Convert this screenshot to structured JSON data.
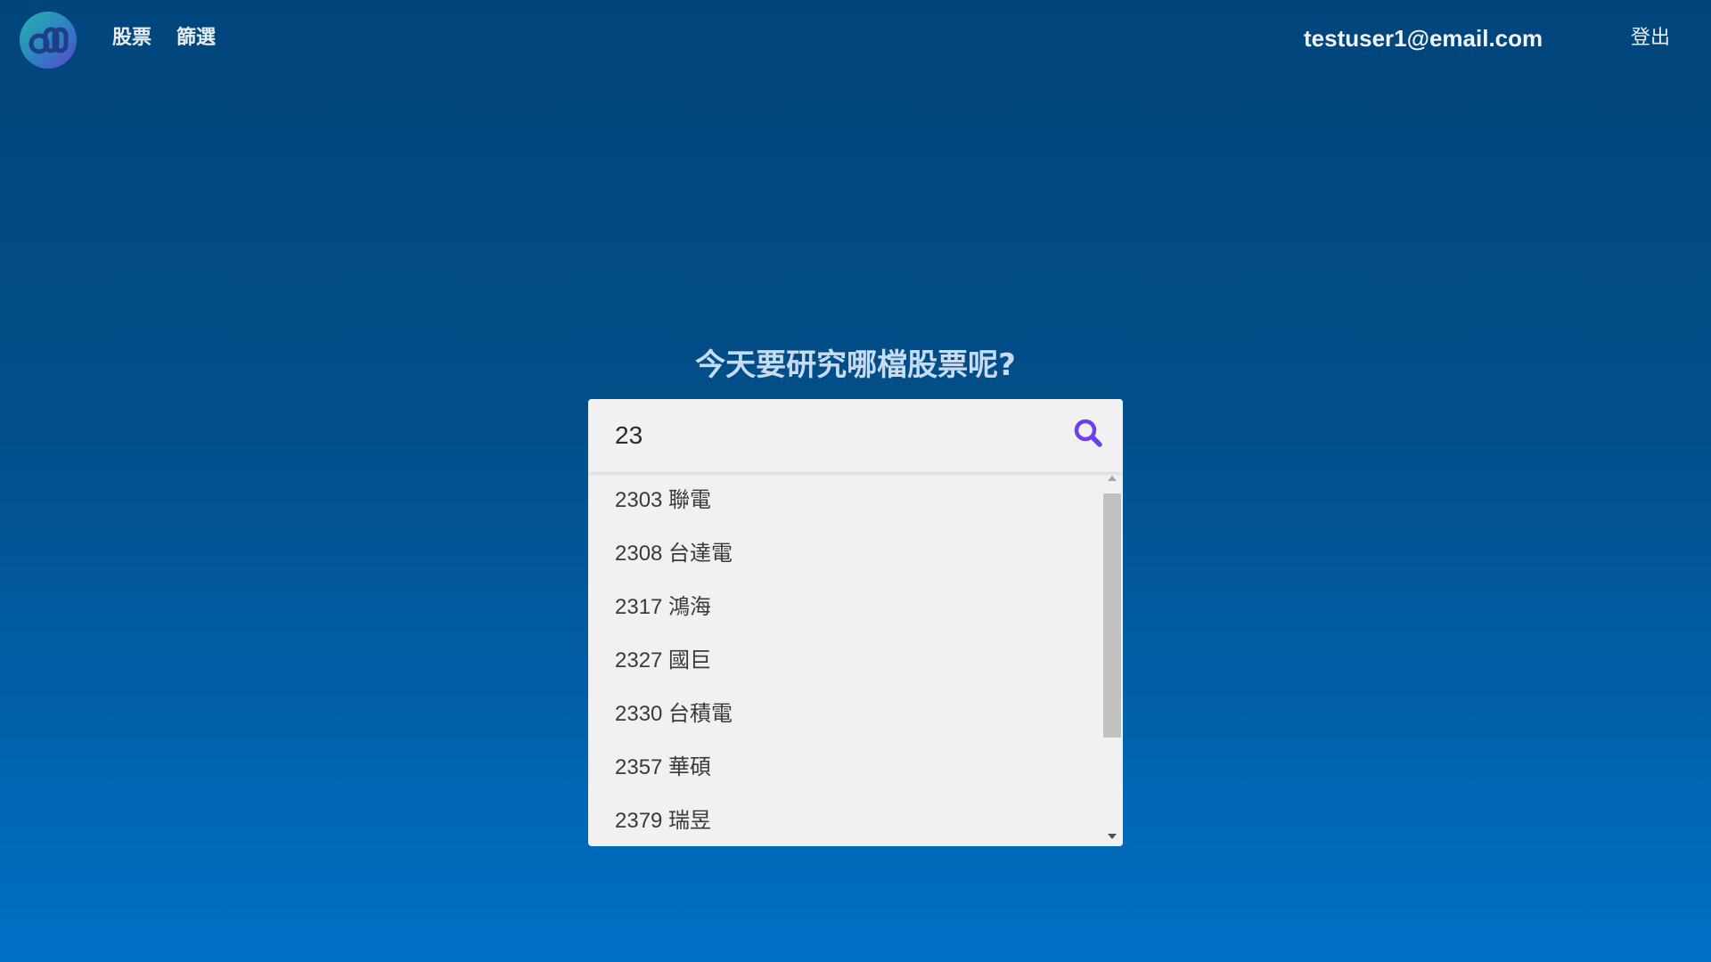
{
  "header": {
    "logo": "app-logo",
    "nav": {
      "stocks": "股票",
      "screener": "篩選"
    },
    "user_email": "testuser1@email.com",
    "logout": "登出"
  },
  "main": {
    "headline": "今天要研究哪檔股票呢?",
    "search": {
      "value": "23",
      "icon": "search-icon",
      "icon_color": "#6c3ff0"
    },
    "results": [
      "2303 聯電",
      "2308 台達電",
      "2317 鴻海",
      "2327 國巨",
      "2330 台積電",
      "2357 華碩",
      "2379 瑞昱"
    ]
  },
  "colors": {
    "background_top": "#01457b",
    "background_bottom": "#0070c6",
    "panel": "#f1f1f1"
  }
}
